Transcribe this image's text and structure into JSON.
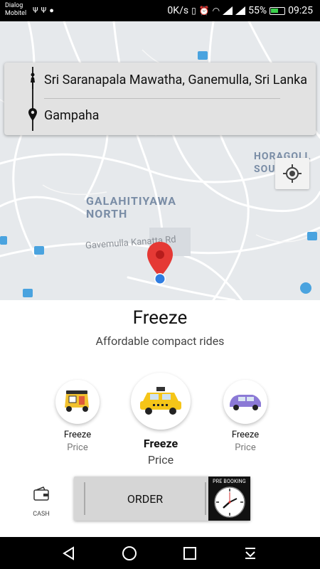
{
  "status_bar": {
    "carrier_line1": "Dialog",
    "carrier_line2": "Mobitel",
    "speed": "0K/s",
    "battery_percent": "55%",
    "time": "09:25",
    "icons": [
      "usb-icon",
      "usb-icon",
      "chat-icon",
      "vibrate-icon",
      "alarm-icon",
      "wifi-icon",
      "signal-icon",
      "signal-icon",
      "battery-icon"
    ]
  },
  "map": {
    "labels": {
      "area1_line1": "GALAHITIYAWA",
      "area1_line2": "NORTH",
      "area2_line1": "HORAGOLL",
      "area2_line2": "SOUTH",
      "road": "Gavemulla Kanatta Rd"
    }
  },
  "route": {
    "pickup": "Sri Saranapala Mawatha, Ganemulla, Sri Lanka",
    "destination": "Gampaha"
  },
  "service": {
    "name": "Freeze",
    "description": "Affordable compact rides"
  },
  "vehicles": [
    {
      "name": "Freeze",
      "price": "Price",
      "icon": "tuk-tuk-icon"
    },
    {
      "name": "Freeze",
      "price": "Price",
      "icon": "taxi-car-icon",
      "selected": true
    },
    {
      "name": "Freeze",
      "price": "Price",
      "icon": "minivan-icon"
    }
  ],
  "payment": {
    "label": "CASH",
    "icon": "wallet-icon"
  },
  "actions": {
    "order_label": "ORDER",
    "prebooking_label": "PRE BOOKING"
  },
  "colors": {
    "marker": "#e53935",
    "user_dot": "#2f7de1",
    "accent": "#111111"
  }
}
